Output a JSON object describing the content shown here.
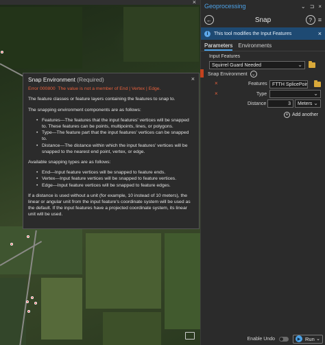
{
  "tooltip": {
    "title": "Snap Environment",
    "required": "(Required)",
    "error_code": "Error 000800",
    "error_text": "The value is not a member of End | Vertex | Edge.",
    "intro": "The feature classes or feature layers containing the features to snap to.",
    "components_heading": "The snapping environment components are as follows:",
    "components": [
      "Features—The features that the input features' vertices will be snapped to. These features can be points, multipoints, lines, or polygons.",
      "Type—The feature part that the input features' vertices can be snapped to.",
      "Distance—The distance within which the input features' vertices will be snapped to the nearest end point, vertex, or edge."
    ],
    "types_heading": "Available snapping types are as follows:",
    "types": [
      "End—Input feature vertices will be snapped to feature ends.",
      "Vertex—Input feature vertices will be snapped to feature vertices.",
      "Edge—Input feature vertices will be snapped to feature edges."
    ],
    "footnote": "If a distance is used without a unit (for example, 10 instead of 10 meters), the linear or angular unit from the input feature's coordinate system will be used as the default. If the input features have a projected coordinate system, its linear unit will be used."
  },
  "pane": {
    "title": "Geoprocessing",
    "tool_title": "Snap",
    "info_message": "This tool modifies the Input Features",
    "tabs": [
      "Parameters",
      "Environments"
    ],
    "input_features_label": "Input Features",
    "input_features_value": "Squirrel Guard Needed",
    "snap_environment_label": "Snap Environment",
    "features_label": "Features",
    "features_value": "FTTH SplicePoir",
    "type_label": "Type",
    "type_value": "",
    "distance_label": "Distance",
    "distance_value": "3",
    "distance_unit": "Meters",
    "add_another": "Add another",
    "enable_undo": "Enable Undo",
    "run_label": "Run"
  },
  "colors": {
    "accent": "#4da3e8",
    "error": "#e8603c",
    "info_bar": "#1e4a73"
  }
}
